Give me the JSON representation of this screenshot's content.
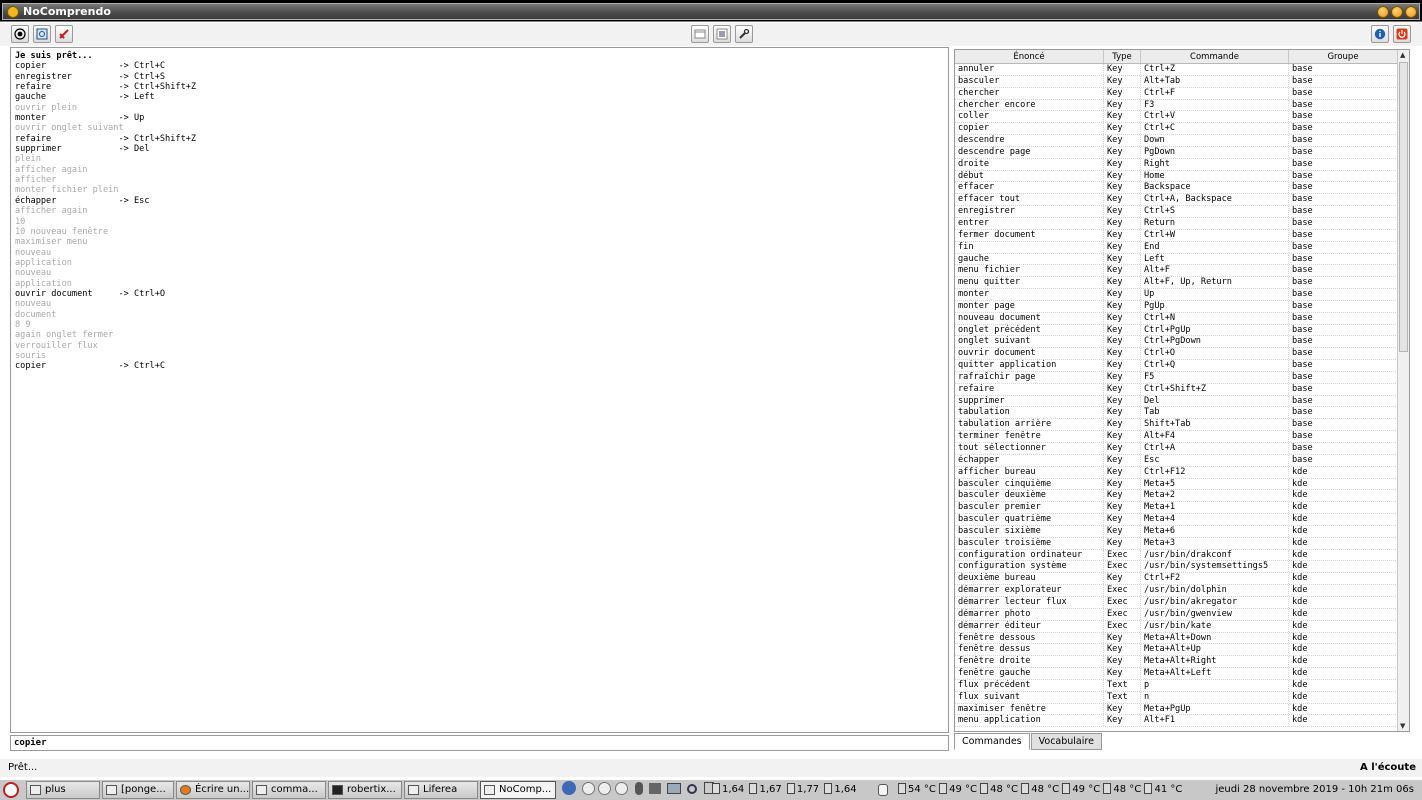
{
  "window": {
    "title": "NoComprendo"
  },
  "console": {
    "lines": [
      {
        "text": "Je suis prêt...",
        "style": "hdr"
      },
      {
        "text": "copier              -> Ctrl+C",
        "style": "ok"
      },
      {
        "text": "enregistrer         -> Ctrl+S",
        "style": "ok"
      },
      {
        "text": "refaire             -> Ctrl+Shift+Z",
        "style": "ok"
      },
      {
        "text": "gauche              -> Left",
        "style": "ok"
      },
      {
        "text": "ouvrir plein",
        "style": "fail"
      },
      {
        "text": "monter              -> Up",
        "style": "ok"
      },
      {
        "text": "ouvrir onglet suivant",
        "style": "fail"
      },
      {
        "text": "refaire             -> Ctrl+Shift+Z",
        "style": "ok"
      },
      {
        "text": "supprimer           -> Del",
        "style": "ok"
      },
      {
        "text": "plein",
        "style": "fail"
      },
      {
        "text": "afficher again",
        "style": "fail"
      },
      {
        "text": "afficher",
        "style": "fail"
      },
      {
        "text": "monter fichier plein",
        "style": "fail"
      },
      {
        "text": "échapper            -> Esc",
        "style": "ok"
      },
      {
        "text": "afficher again",
        "style": "fail"
      },
      {
        "text": "10",
        "style": "fail"
      },
      {
        "text": "10 nouveau fenêtre",
        "style": "fail"
      },
      {
        "text": "maximiser menu",
        "style": "fail"
      },
      {
        "text": "nouveau",
        "style": "fail"
      },
      {
        "text": "application",
        "style": "fail"
      },
      {
        "text": "nouveau",
        "style": "fail"
      },
      {
        "text": "application",
        "style": "fail"
      },
      {
        "text": "ouvrir document     -> Ctrl+O",
        "style": "ok"
      },
      {
        "text": "nouveau",
        "style": "fail"
      },
      {
        "text": "document",
        "style": "fail"
      },
      {
        "text": "8 9",
        "style": "fail"
      },
      {
        "text": "again onglet fermer",
        "style": "fail"
      },
      {
        "text": "verrouiller flux",
        "style": "fail"
      },
      {
        "text": "souris",
        "style": "fail"
      },
      {
        "text": "copier              -> Ctrl+C",
        "style": "ok"
      }
    ]
  },
  "input": {
    "value": "copier"
  },
  "table": {
    "headers": [
      "Énoncé",
      "Type",
      "Commande",
      "Groupe"
    ],
    "rows": [
      [
        "annuler",
        "Key",
        "Ctrl+Z",
        "base"
      ],
      [
        "basculer",
        "Key",
        "Alt+Tab",
        "base"
      ],
      [
        "chercher",
        "Key",
        "Ctrl+F",
        "base"
      ],
      [
        "chercher encore",
        "Key",
        "F3",
        "base"
      ],
      [
        "coller",
        "Key",
        "Ctrl+V",
        "base"
      ],
      [
        "copier",
        "Key",
        "Ctrl+C",
        "base"
      ],
      [
        "descendre",
        "Key",
        "Down",
        "base"
      ],
      [
        "descendre page",
        "Key",
        "PgDown",
        "base"
      ],
      [
        "droite",
        "Key",
        "Right",
        "base"
      ],
      [
        "début",
        "Key",
        "Home",
        "base"
      ],
      [
        "effacer",
        "Key",
        "Backspace",
        "base"
      ],
      [
        "effacer tout",
        "Key",
        "Ctrl+A, Backspace",
        "base"
      ],
      [
        "enregistrer",
        "Key",
        "Ctrl+S",
        "base"
      ],
      [
        "entrer",
        "Key",
        "Return",
        "base"
      ],
      [
        "fermer document",
        "Key",
        "Ctrl+W",
        "base"
      ],
      [
        "fin",
        "Key",
        "End",
        "base"
      ],
      [
        "gauche",
        "Key",
        "Left",
        "base"
      ],
      [
        "menu fichier",
        "Key",
        "Alt+F",
        "base"
      ],
      [
        "menu quitter",
        "Key",
        "Alt+F, Up, Return",
        "base"
      ],
      [
        "monter",
        "Key",
        "Up",
        "base"
      ],
      [
        "monter page",
        "Key",
        "PgUp",
        "base"
      ],
      [
        "nouveau document",
        "Key",
        "Ctrl+N",
        "base"
      ],
      [
        "onglet précédent",
        "Key",
        "Ctrl+PgUp",
        "base"
      ],
      [
        "onglet suivant",
        "Key",
        "Ctrl+PgDown",
        "base"
      ],
      [
        "ouvrir document",
        "Key",
        "Ctrl+O",
        "base"
      ],
      [
        "quitter application",
        "Key",
        "Ctrl+Q",
        "base"
      ],
      [
        "rafraîchir page",
        "Key",
        "F5",
        "base"
      ],
      [
        "refaire",
        "Key",
        "Ctrl+Shift+Z",
        "base"
      ],
      [
        "supprimer",
        "Key",
        "Del",
        "base"
      ],
      [
        "tabulation",
        "Key",
        "Tab",
        "base"
      ],
      [
        "tabulation arrière",
        "Key",
        "Shift+Tab",
        "base"
      ],
      [
        "terminer fenêtre",
        "Key",
        "Alt+F4",
        "base"
      ],
      [
        "tout sélectionner",
        "Key",
        "Ctrl+A",
        "base"
      ],
      [
        "échapper",
        "Key",
        "Esc",
        "base"
      ],
      [
        "afficher bureau",
        "Key",
        "Ctrl+F12",
        "kde"
      ],
      [
        "basculer cinquième",
        "Key",
        "Meta+5",
        "kde"
      ],
      [
        "basculer deuxième",
        "Key",
        "Meta+2",
        "kde"
      ],
      [
        "basculer premier",
        "Key",
        "Meta+1",
        "kde"
      ],
      [
        "basculer quatrième",
        "Key",
        "Meta+4",
        "kde"
      ],
      [
        "basculer sixième",
        "Key",
        "Meta+6",
        "kde"
      ],
      [
        "basculer troisième",
        "Key",
        "Meta+3",
        "kde"
      ],
      [
        "configuration ordinateur",
        "Exec",
        "/usr/bin/drakconf",
        "kde"
      ],
      [
        "configuration système",
        "Exec",
        "/usr/bin/systemsettings5",
        "kde"
      ],
      [
        "deuxième bureau",
        "Key",
        "Ctrl+F2",
        "kde"
      ],
      [
        "démarrer explorateur",
        "Exec",
        "/usr/bin/dolphin",
        "kde"
      ],
      [
        "démarrer lecteur flux",
        "Exec",
        "/usr/bin/akregator",
        "kde"
      ],
      [
        "démarrer photo",
        "Exec",
        "/usr/bin/gwenview",
        "kde"
      ],
      [
        "démarrer éditeur",
        "Exec",
        "/usr/bin/kate",
        "kde"
      ],
      [
        "fenêtre dessous",
        "Key",
        "Meta+Alt+Down",
        "kde"
      ],
      [
        "fenêtre dessus",
        "Key",
        "Meta+Alt+Up",
        "kde"
      ],
      [
        "fenêtre droite",
        "Key",
        "Meta+Alt+Right",
        "kde"
      ],
      [
        "fenêtre gauche",
        "Key",
        "Meta+Alt+Left",
        "kde"
      ],
      [
        "flux précédent",
        "Text",
        "p",
        "kde"
      ],
      [
        "flux suivant",
        "Text",
        "n",
        "kde"
      ],
      [
        "maximiser fenêtre",
        "Key",
        "Meta+PgUp",
        "kde"
      ],
      [
        "menu application",
        "Key",
        "Alt+F1",
        "kde"
      ]
    ]
  },
  "tabs": [
    {
      "label": "Commandes",
      "active": true
    },
    {
      "label": "Vocabulaire",
      "active": false
    }
  ],
  "status": {
    "left": "Prêt...",
    "right": "A l'écoute"
  },
  "taskbar": {
    "tasks": [
      "plus",
      "[ponge...",
      "Écrire un...",
      "comma...",
      "robertix...",
      "Liferea",
      "NoComp..."
    ],
    "tray": [
      "1,64",
      "1,67",
      "1,77",
      "1,64"
    ],
    "temps": [
      "54 °C",
      "49 °C",
      "48 °C",
      "48 °C",
      "49 °C",
      "48 °C",
      "41 °C"
    ],
    "clock": "jeudi 28 novembre 2019 - 10h 21m 06s"
  },
  "colors": {
    "recognized": "#000000",
    "unrecognized": "#a8a8a8",
    "title_accent": "#f1b71b"
  }
}
